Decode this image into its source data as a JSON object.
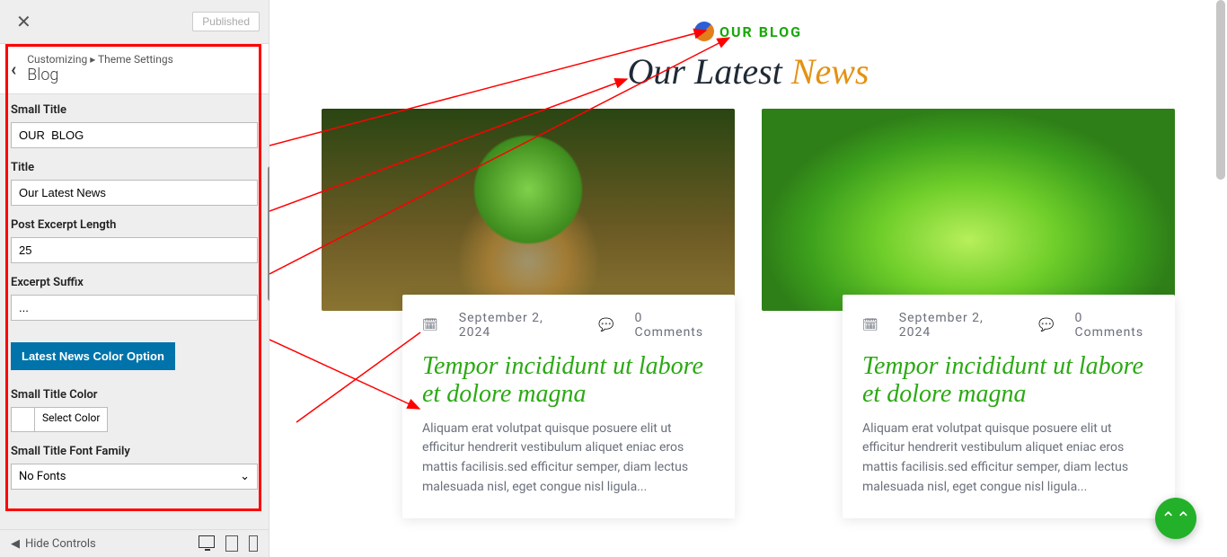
{
  "topbar": {
    "published_label": "Published"
  },
  "breadcrumb": {
    "prefix": "Customizing",
    "mid": "Theme Settings",
    "current": "Blog"
  },
  "fields": {
    "small_title": {
      "label": "Small Title",
      "value": "OUR  BLOG"
    },
    "title": {
      "label": "Title",
      "value": "Our Latest News"
    },
    "excerpt_len": {
      "label": "Post Excerpt Length",
      "value": "25"
    },
    "excerpt_suffix": {
      "label": "Excerpt Suffix",
      "value": "..."
    },
    "section_button": "Latest News Color Option",
    "small_title_color": {
      "label": "Small Title Color",
      "picker": "Select Color"
    },
    "small_title_font": {
      "label": "Small Title Font Family",
      "value": "No Fonts"
    }
  },
  "footer": {
    "hide": "Hide Controls"
  },
  "preview": {
    "small_title": "OUR BLOG",
    "title_pre": "Our Latest",
    "title_accent": "News",
    "posts": [
      {
        "date": "September 2, 2024",
        "comments": "0 Comments",
        "title": "Tempor incididunt ut labore et dolore magna",
        "excerpt": "Aliquam erat volutpat quisque posuere elit ut efficitur hendrerit vestibulum aliquet eniac eros mattis facilisis.sed efficitur semper, diam lectus malesuada nisl, eget congue nisl ligula..."
      },
      {
        "date": "September 2, 2024",
        "comments": "0 Comments",
        "title": "Tempor incididunt ut labore et dolore magna",
        "excerpt": "Aliquam erat volutpat quisque posuere elit ut efficitur hendrerit vestibulum aliquet eniac eros mattis facilisis.sed efficitur semper, diam lectus malesuada nisl, eget congue nisl ligula..."
      }
    ]
  }
}
